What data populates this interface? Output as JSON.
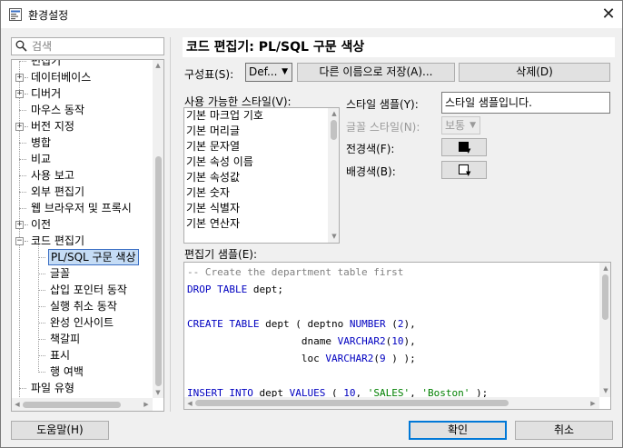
{
  "window": {
    "title": "환경설정",
    "close_glyph": "✕"
  },
  "search": {
    "placeholder": "검색",
    "value": ""
  },
  "tree": {
    "items": [
      {
        "label": "편집기"
      },
      {
        "label": "데이터베이스"
      },
      {
        "label": "디버거"
      },
      {
        "label": "마우스 동작"
      },
      {
        "label": "버전 지정"
      },
      {
        "label": "병합"
      },
      {
        "label": "비교"
      },
      {
        "label": "사용 보고"
      },
      {
        "label": "외부 편집기"
      },
      {
        "label": "웹 브라우저 및 프록시"
      },
      {
        "label": "이전"
      },
      {
        "label": "코드 편집기"
      },
      {
        "label": "PL/SQL 구문 색상"
      },
      {
        "label": "글꼴"
      },
      {
        "label": "삽입 포인터 동작"
      },
      {
        "label": "실행 취소 동작"
      },
      {
        "label": "완성 인사이트"
      },
      {
        "label": "책갈피"
      },
      {
        "label": "표시"
      },
      {
        "label": "행 여백"
      },
      {
        "label": "파일 유형"
      }
    ],
    "expander_plus": "+",
    "expander_minus": "−"
  },
  "page": {
    "heading": "코드 편집기: PL/SQL 구문 색상"
  },
  "scheme": {
    "label": "구성표(S):",
    "selected": "Def...",
    "save_as_label": "다른 이름으로 저장(A)...",
    "delete_label": "삭제(D)"
  },
  "styles": {
    "label": "사용 가능한 스타일(V):",
    "items": [
      "기본 마크업 기호",
      "기본 머리글",
      "기본 문자열",
      "기본 속성 이름",
      "기본 속성값",
      "기본 숫자",
      "기본 식별자",
      "기본 연산자"
    ]
  },
  "style_sample": {
    "label": "스타일 샘플(Y):",
    "value": "스타일 샘플입니다."
  },
  "font_style": {
    "label": "글꼴 스타일(N):",
    "selected": "보통"
  },
  "foreground": {
    "label": "전경색(F):",
    "color": "#000000"
  },
  "background": {
    "label": "배경색(B):",
    "color": "#ffffff"
  },
  "editor_sample": {
    "label": "편집기 샘플(E):",
    "comment": "-- Create the department table first",
    "kw_drop": "DROP",
    "kw_table": "TABLE",
    "t_dept": "dept",
    "semi": ";",
    "kw_create": "CREATE",
    "t_open": "dept ( deptno",
    "kw_number": "NUMBER",
    "n2": "2",
    "p_close_comma": "),",
    "col_dname": "dname",
    "kw_varchar2": "VARCHAR2",
    "n10": "10",
    "col_loc": "loc",
    "n9": "9",
    "p_end": ") );",
    "kw_insert": "INSERT",
    "kw_into": "INTO",
    "kw_values": "VALUES",
    "n10b": "10",
    "s_sales": "'SALES'",
    "s_boston": "'Boston'",
    "p_end2": ");"
  },
  "footer": {
    "help_label": "도움말(H)",
    "ok_label": "확인",
    "cancel_label": "취소"
  },
  "colors": {
    "accent": "#0078d7",
    "keyword": "#0000c0",
    "comment": "#808080",
    "string": "#008000",
    "selection": "#c5dcf5"
  }
}
